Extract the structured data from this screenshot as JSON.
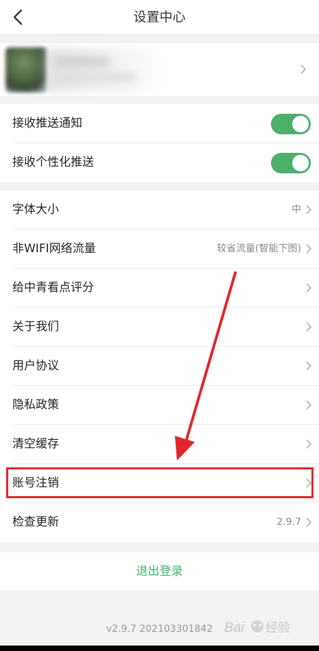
{
  "header": {
    "title": "设置中心"
  },
  "notifications": [
    {
      "label": "接收推送通知",
      "enabled": true
    },
    {
      "label": "接收个性化推送",
      "enabled": true
    }
  ],
  "settings": [
    {
      "label": "字体大小",
      "value": "中"
    },
    {
      "label": "非WIFI网络流量",
      "value": "较省流量(智能下图)"
    },
    {
      "label": "给中青看点评分",
      "value": ""
    },
    {
      "label": "关于我们",
      "value": ""
    },
    {
      "label": "用户协议",
      "value": ""
    },
    {
      "label": "隐私政策",
      "value": ""
    },
    {
      "label": "清空缓存",
      "value": ""
    },
    {
      "label": "账号注销",
      "value": ""
    },
    {
      "label": "检查更新",
      "value": "2.9.7"
    }
  ],
  "logout_label": "退出登录",
  "version_text": "v2.9.7 202103301842",
  "watermark_text": "Bai 经验",
  "colors": {
    "accent_green": "#3cb36a",
    "toggle_green": "#4caf6a",
    "highlight_red": "#e0252d"
  }
}
